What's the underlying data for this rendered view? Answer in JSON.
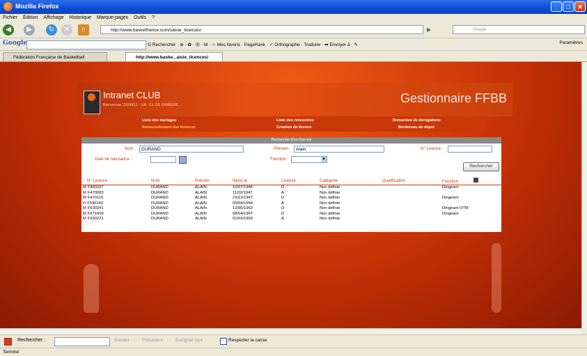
{
  "window": {
    "title": "Mozilla Firefox"
  },
  "menu": [
    "Fichier",
    "Édition",
    "Affichage",
    "Historique",
    "Marque-pages",
    "Outils",
    "?"
  ],
  "address": {
    "url": "http://www.basketfrance.com/saisie_licences/"
  },
  "search_box": {
    "placeholder": "Google"
  },
  "google_toolbar": {
    "logo": "Google",
    "items": "G Rechercher · ⊕ · ✿ · Ⓑ · M · ☆ Mes favoris · PageRank · ✓ Orthographe · Traduire · ➡ Envoyer à · ✎",
    "params": "Paramètres"
  },
  "tabs": [
    {
      "label": "Fédération Française de Basketball",
      "active": false
    },
    {
      "label": "http://www.baske...aisie_licences/",
      "active": true
    }
  ],
  "page": {
    "intranet": "Intranet CLUB",
    "welcome": "Bienvenue 2309002 - UN ·CL DE FAMIERE",
    "brand": "Gestionnaire FFBB",
    "nav": [
      {
        "label": "Liste des mariages",
        "hl": false
      },
      {
        "label": "Liste des rencontres",
        "hl": false
      },
      {
        "label": "Demandes de dérogations",
        "hl": false
      },
      {
        "label": "Renouvellement des licences",
        "hl": true
      },
      {
        "label": "Création de licence",
        "hl": false
      },
      {
        "label": "Bordereau de dépot",
        "hl": false
      }
    ],
    "panel_title": "Recherche d'un licencié",
    "form": {
      "nom_label": "Nom :",
      "nom_value": "DURAND",
      "prenom_label": "Prénom :",
      "prenom_value": "Alain",
      "licence_label": "N° Licence :",
      "licence_value": "",
      "naissance_label": "Date de naissance :",
      "naissance_value": "",
      "fonction_label": "Fonction :",
      "fonction_value": "",
      "search_button": "Rechercher"
    },
    "table": {
      "headers": [
        "N° Licence",
        "Nom",
        "Prénom",
        "Né(e) le",
        "Licence",
        "Catégorie",
        "Qualification",
        "Fonction"
      ],
      "rows": [
        {
          "mark": "M",
          "licence": "F460327",
          "nom": "DURAND",
          "prenom": "ALAIN",
          "ne": "10/07/1946",
          "lic": "D",
          "cat": "Non définie",
          "qual": "",
          "fonc": "Dirigeant"
        },
        {
          "mark": "M",
          "licence": "F470083",
          "nom": "DURAND",
          "prenom": "ALAIN",
          "ne": "11/02/1947",
          "lic": "A",
          "cat": "Non définie",
          "qual": "",
          "fonc": ""
        },
        {
          "mark": "M",
          "licence": "F470115",
          "nom": "DURAND",
          "prenom": "ALAIN",
          "ne": "23/12/1947",
          "lic": "D",
          "cat": "Non définie",
          "qual": "",
          "fonc": "Dirigeant"
        },
        {
          "mark": "H",
          "licence": "F540141",
          "nom": "DURAND",
          "prenom": "ALAIN",
          "ne": "05/04/1954",
          "lic": "A",
          "cat": "Non définie",
          "qual": "",
          "fonc": ""
        },
        {
          "mark": "M",
          "licence": "F630241",
          "nom": "DURAND",
          "prenom": "ALAIN",
          "ne": "12/06/1963",
          "lic": "D",
          "cat": "Non définie",
          "qual": "",
          "fonc": "Dirigeant OTM"
        },
        {
          "mark": "M",
          "licence": "F671609",
          "nom": "DURAND",
          "prenom": "ALAIN",
          "ne": "08/04/1967",
          "lic": "D",
          "cat": "Non définie",
          "qual": "",
          "fonc": "Dirigeant"
        },
        {
          "mark": "M",
          "licence": "F930221",
          "nom": "DURAND",
          "prenom": "ALAIN",
          "ne": "01/03/1993",
          "lic": "A",
          "cat": "Non définie",
          "qual": "",
          "fonc": ""
        }
      ]
    }
  },
  "findbar": {
    "label": "Rechercher :",
    "next": "Suivant",
    "prev": "Précédent",
    "highlight": "Surligner tout",
    "case": "Respecter la casse"
  },
  "status": "Terminé"
}
